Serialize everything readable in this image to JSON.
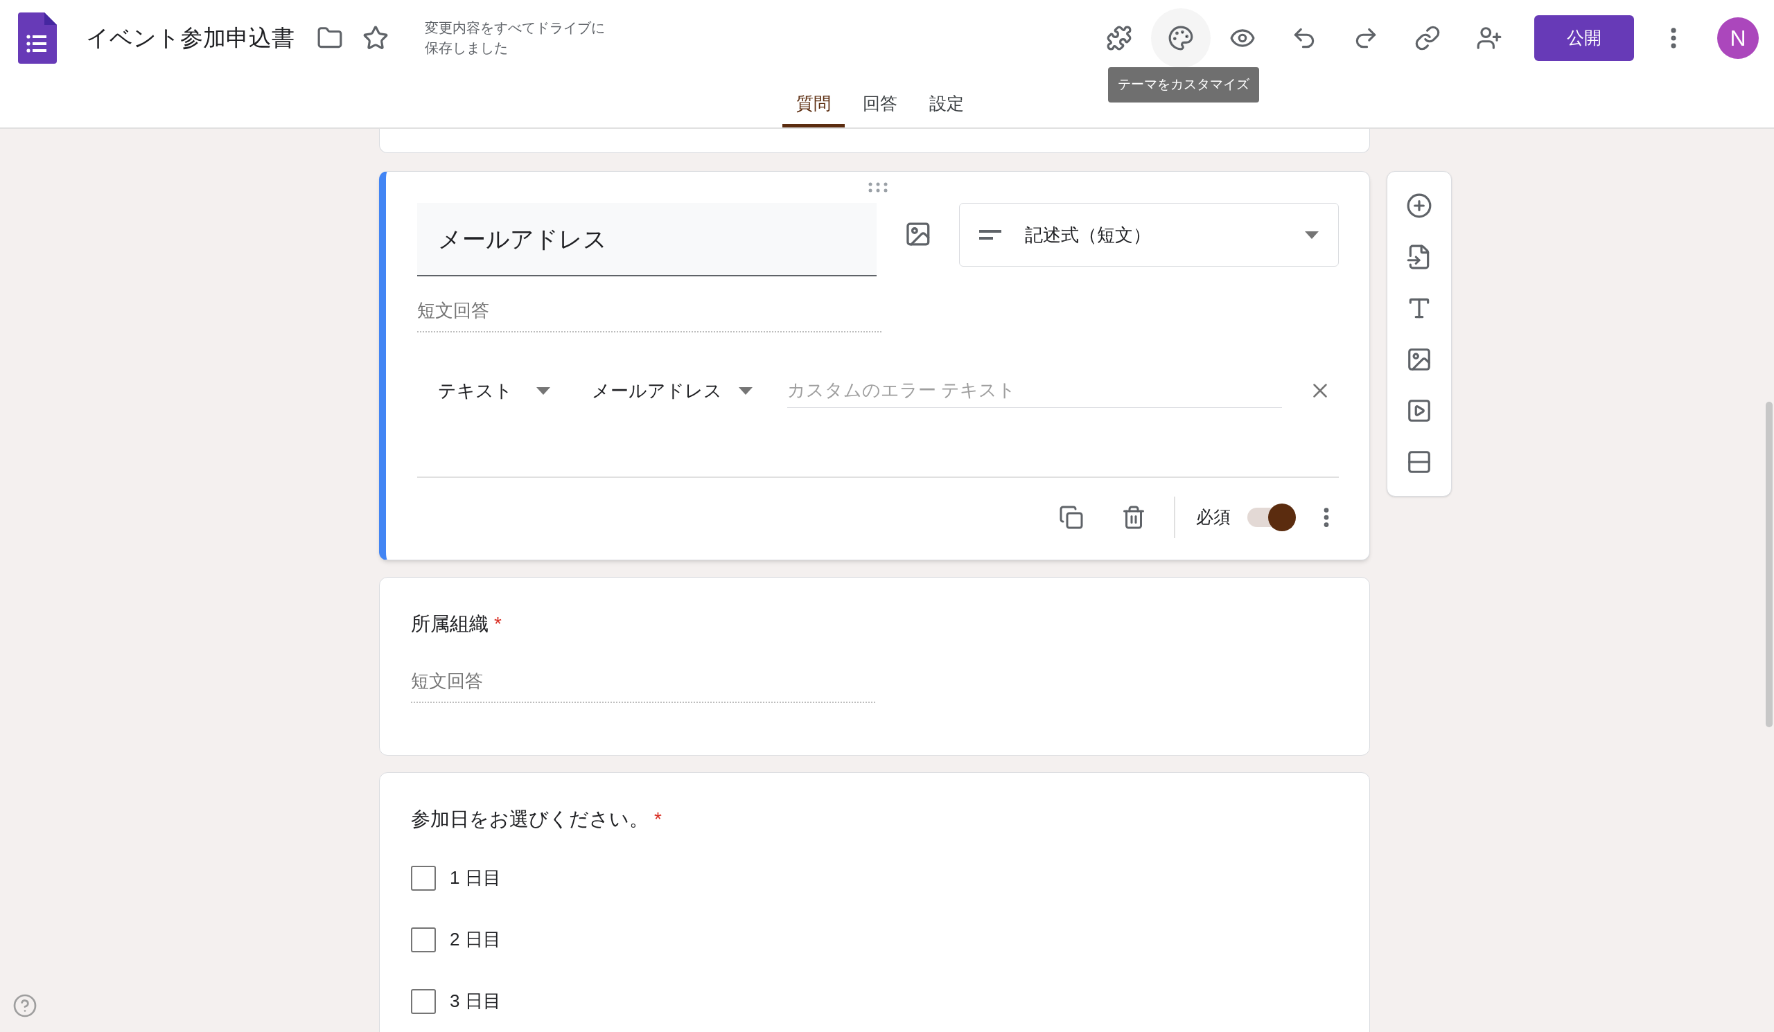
{
  "header": {
    "title": "イベント参加申込書",
    "save_status": [
      "変更内容をすべてドライブに",
      "保存しました"
    ],
    "tooltip": "テーマをカスタマイズ",
    "publish_button": "公開",
    "avatar": "N"
  },
  "tabs": [
    {
      "label": "質問",
      "selected": true
    },
    {
      "label": "回答",
      "selected": false
    },
    {
      "label": "設定",
      "selected": false
    }
  ],
  "questions": [
    {
      "kind": "short_answer",
      "editing": true,
      "title": "メールアドレス",
      "type": "記述式（短文）",
      "answer_placeholder": "短文回答",
      "validation": {
        "type": "テキスト",
        "condition": "メールアドレス",
        "error_placeholder": "カスタムのエラー テキスト"
      },
      "required_label": "必須",
      "required": true
    },
    {
      "kind": "short_answer",
      "editing": false,
      "title": "所属組織",
      "required": true,
      "required_mark": "*",
      "answer_placeholder": "短文回答"
    },
    {
      "kind": "checkboxes",
      "editing": false,
      "title": "参加日をお選びください。",
      "required": true,
      "required_mark": "*",
      "options": [
        {
          "label": "1 日目",
          "checked": false
        },
        {
          "label": "2 日目",
          "checked": false
        },
        {
          "label": "3 日目",
          "checked": false
        }
      ]
    }
  ]
}
